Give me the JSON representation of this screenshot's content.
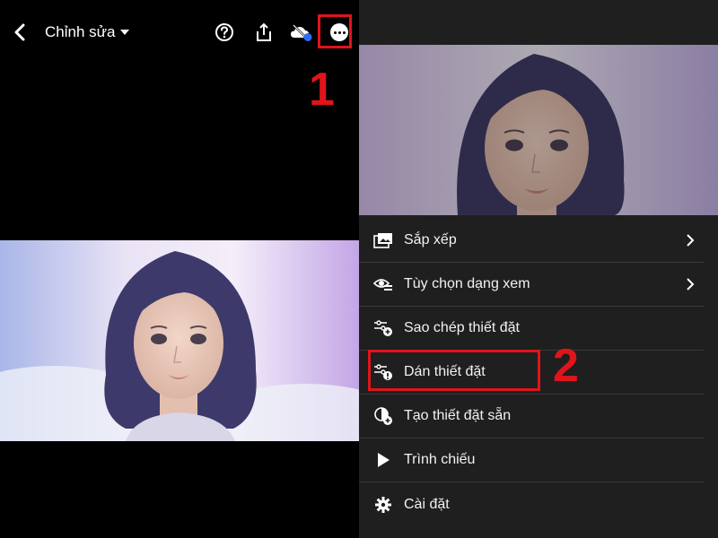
{
  "header": {
    "title": "Chỉnh sửa"
  },
  "icons": {
    "back": "chevron-left-icon",
    "title_dropdown": "caret-down-icon",
    "help": "help-circle-icon",
    "share": "share-icon",
    "cloud": "cloud-off-icon",
    "more": "more-icon"
  },
  "annotations": {
    "step1": "1",
    "step2": "2",
    "highlight_color": "#e0141b"
  },
  "menu": {
    "items": [
      {
        "label": "Sắp xếp",
        "icon": "sort-icon",
        "has_submenu": true
      },
      {
        "label": "Tùy chọn dạng xem",
        "icon": "view-options-icon",
        "has_submenu": true
      },
      {
        "label": "Sao chép thiết đặt",
        "icon": "copy-settings-icon",
        "has_submenu": false
      },
      {
        "label": "Dán thiết đặt",
        "icon": "paste-settings-icon",
        "has_submenu": false
      },
      {
        "label": "Tạo thiết đặt sẵn",
        "icon": "create-preset-icon",
        "has_submenu": false
      },
      {
        "label": "Trình chiếu",
        "icon": "play-icon",
        "has_submenu": false
      },
      {
        "label": "Cài đặt",
        "icon": "gear-icon",
        "has_submenu": false
      }
    ]
  },
  "colors": {
    "background": "#000000",
    "menu_background": "#1f1f1f",
    "cloud_badge": "#2f6cf6"
  }
}
